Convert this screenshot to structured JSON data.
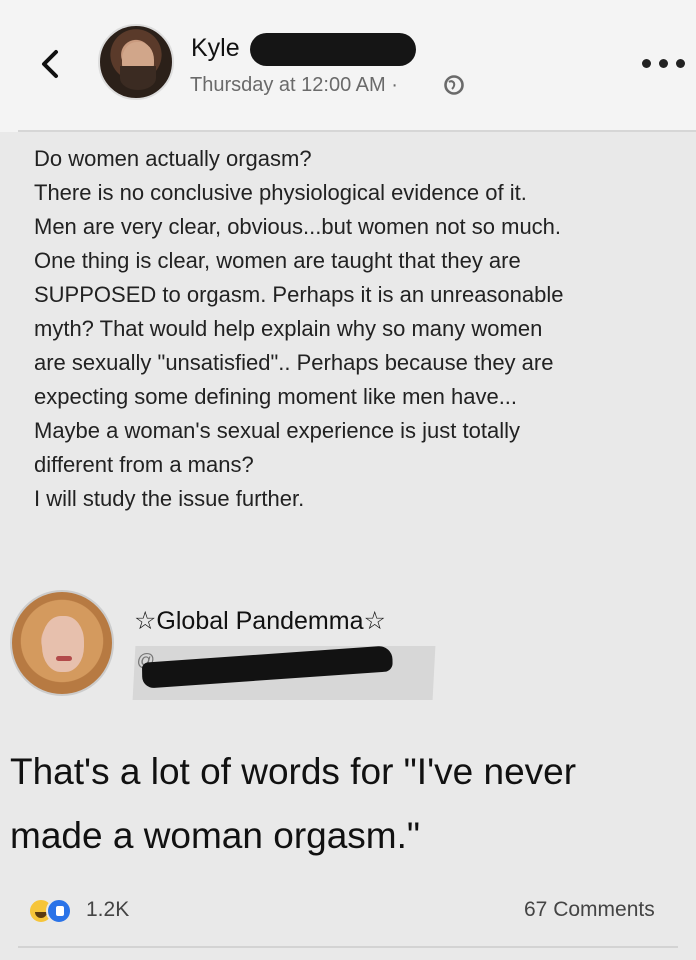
{
  "post": {
    "author_name": "Kyle",
    "timestamp": "Thursday at 12:00 AM ·",
    "body": "Do women actually orgasm?\nThere is no conclusive physiological evidence of it.\nMen are very clear, obvious...but women not so much.\nOne thing is clear, women are taught that they are\nSUPPOSED to orgasm.  Perhaps it is an unreasonable\nmyth? That would help explain why so many women\nare sexually \"unsatisfied\".. Perhaps because they are\nexpecting some defining moment like men have...\nMaybe a woman's sexual experience is just totally\ndifferent from a mans?\nI will study the issue further."
  },
  "reply": {
    "author_name": "☆Global Pandemma☆",
    "handle_prefix": "@",
    "text": "That's a lot of words for \"I've never\nmade a woman orgasm.\""
  },
  "footer": {
    "reaction_count": "1.2K",
    "comments_count": "67 Comments"
  },
  "icons": {
    "back": "chevron-left-icon",
    "privacy": "globe-icon",
    "more": "more-dots-icon",
    "reaction_1": "laugh-reaction-icon",
    "reaction_2": "like-reaction-icon"
  },
  "colors": {
    "background": "#e9e9e9",
    "text": "#1c1c1c",
    "secondary_text": "#6a6a6a",
    "like_blue": "#2a73e8",
    "laugh_yellow": "#f6c53a"
  }
}
